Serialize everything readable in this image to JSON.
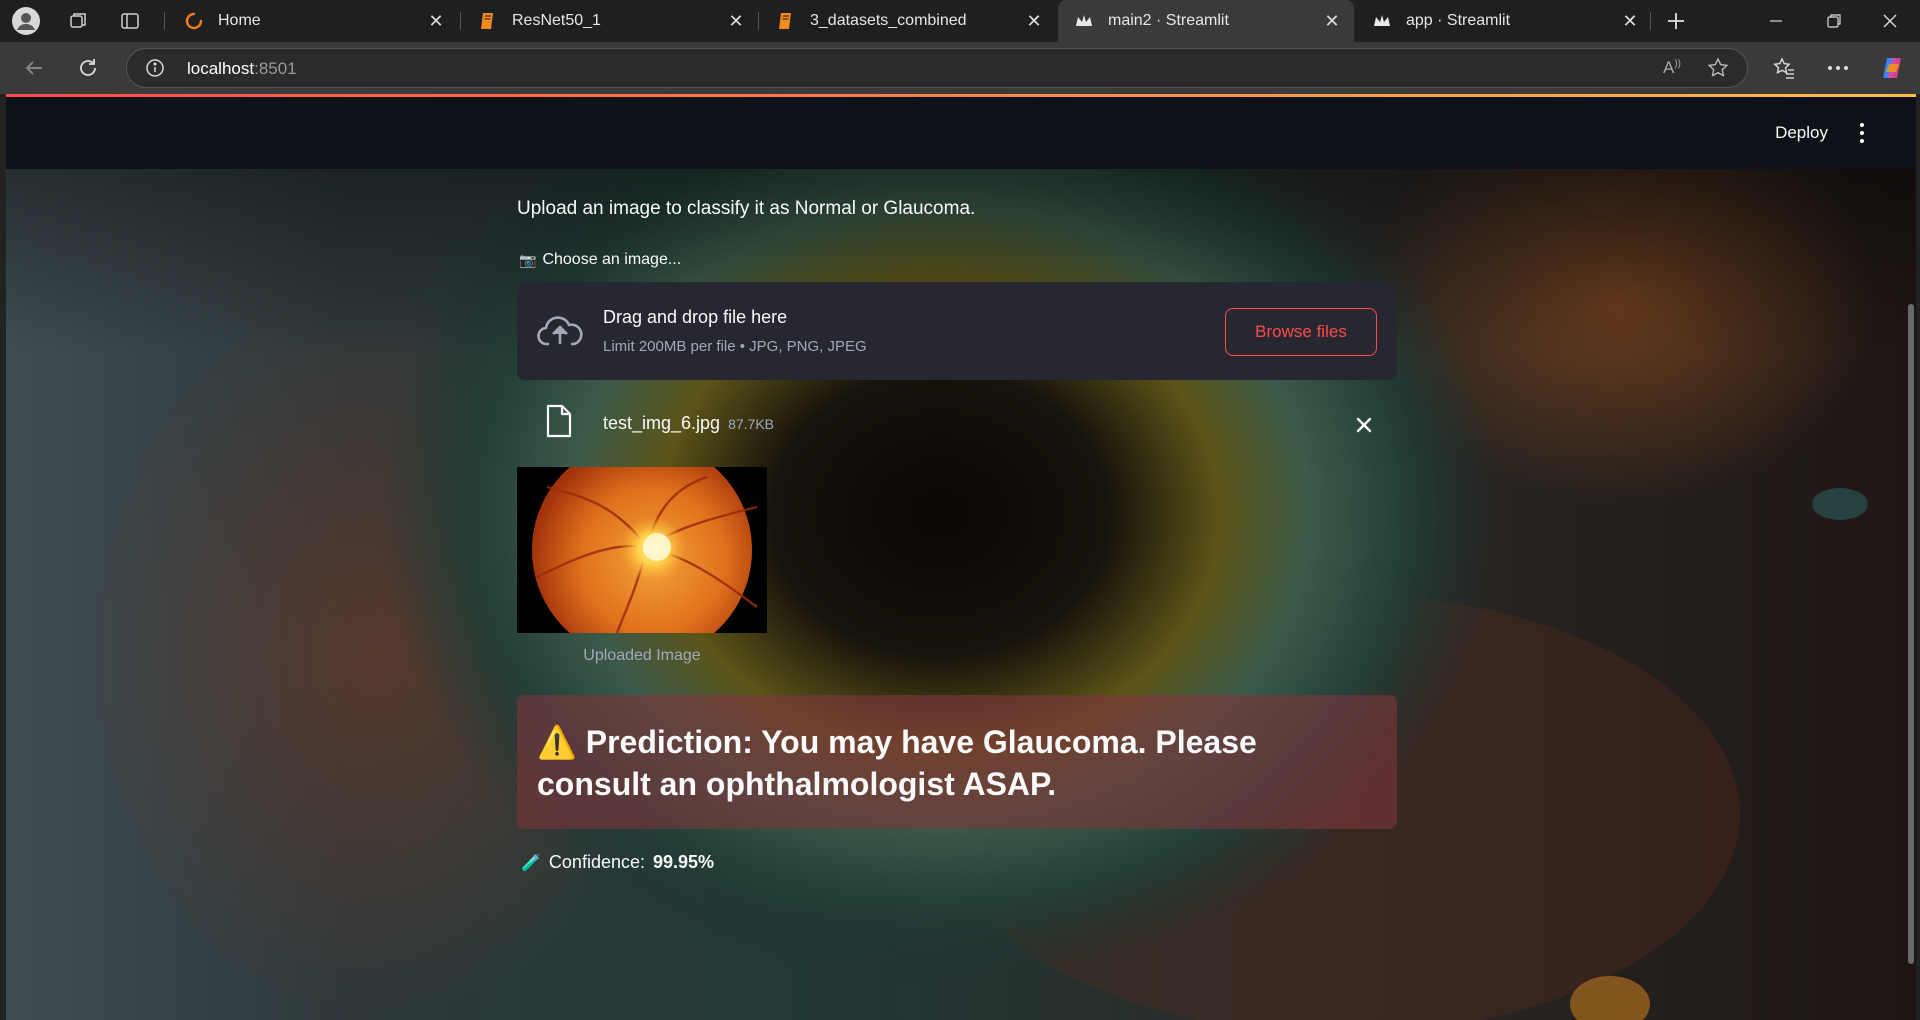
{
  "browser": {
    "tabs": [
      {
        "label": "Home",
        "favicon": "loading-ring-icon"
      },
      {
        "label": "ResNet50_1",
        "favicon": "notebook-icon"
      },
      {
        "label": "3_datasets_combined",
        "favicon": "notebook-icon"
      },
      {
        "label": "main2 · Streamlit",
        "favicon": "streamlit-crown-icon",
        "active": true
      },
      {
        "label": "app · Streamlit",
        "favicon": "streamlit-crown-icon"
      }
    ],
    "address": {
      "host": "localhost",
      "port": ":8501"
    }
  },
  "app": {
    "header": {
      "deploy_label": "Deploy"
    },
    "intro_text": "Upload an image to classify it as Normal or Glaucoma.",
    "uploader": {
      "label_icon": "📷",
      "label": "Choose an image...",
      "drop_title": "Drag and drop file here",
      "drop_limit": "Limit 200MB per file • JPG, PNG, JPEG",
      "browse_label": "Browse files"
    },
    "file": {
      "name": "test_img_6.jpg",
      "size": "87.7KB"
    },
    "image_caption": "Uploaded Image",
    "prediction": {
      "icon": "⚠️",
      "text": "Prediction: You may have Glaucoma. Please consult an ophthalmologist ASAP."
    },
    "confidence": {
      "icon": "🧪",
      "label": "Confidence:",
      "value": "99.95%"
    }
  },
  "colors": {
    "accent": "#ff4b4b",
    "header_bg": "#0e1117",
    "dropzone_bg": "#262730",
    "alert_bg": "#7d353b"
  }
}
